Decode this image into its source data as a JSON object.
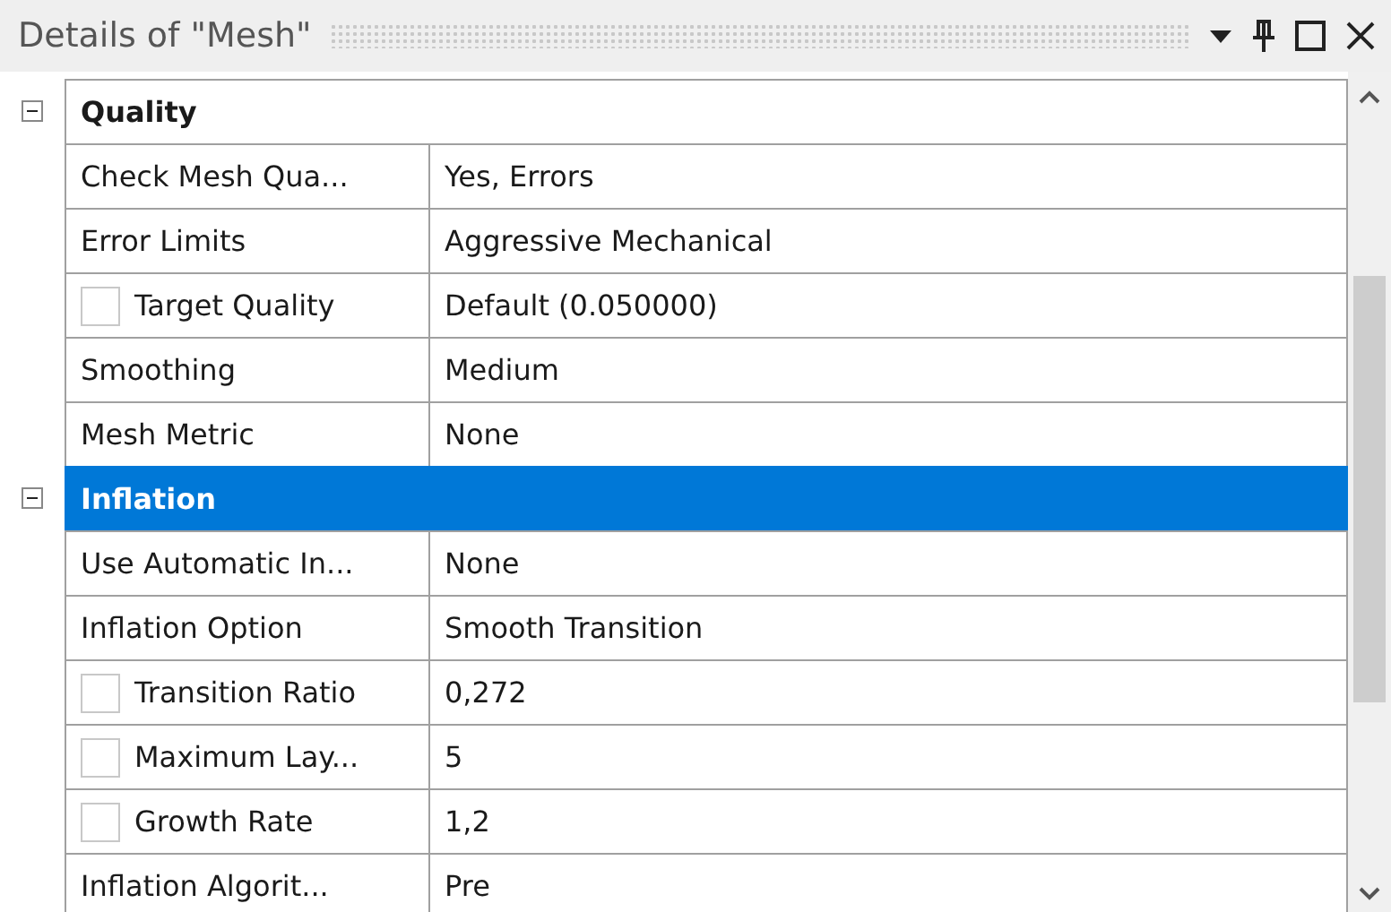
{
  "window": {
    "title": "Details of \"Mesh\""
  },
  "groups": [
    {
      "label": "Quality",
      "expanded": true,
      "selected": false,
      "rows": [
        {
          "kind": "plain",
          "label": "Check Mesh Qua...",
          "value": "Yes, Errors"
        },
        {
          "kind": "plain",
          "label": "Error Limits",
          "value": "Aggressive Mechanical"
        },
        {
          "kind": "checkbox",
          "checked": false,
          "label": "Target Quality",
          "value": "Default (0.050000)"
        },
        {
          "kind": "plain",
          "label": "Smoothing",
          "value": "Medium"
        },
        {
          "kind": "plain",
          "label": "Mesh Metric",
          "value": "None"
        }
      ]
    },
    {
      "label": "Inflation",
      "expanded": true,
      "selected": true,
      "rows": [
        {
          "kind": "plain",
          "label": "Use Automatic In...",
          "value": "None"
        },
        {
          "kind": "plain",
          "label": "Inflation Option",
          "value": "Smooth Transition"
        },
        {
          "kind": "checkbox",
          "checked": false,
          "label": "Transition Ratio",
          "value": "0,272"
        },
        {
          "kind": "checkbox",
          "checked": false,
          "label": "Maximum Lay...",
          "value": "5"
        },
        {
          "kind": "checkbox",
          "checked": false,
          "label": "Growth Rate",
          "value": "1,2"
        },
        {
          "kind": "plain",
          "label": "Inflation Algorit...",
          "value": "Pre"
        }
      ]
    }
  ]
}
